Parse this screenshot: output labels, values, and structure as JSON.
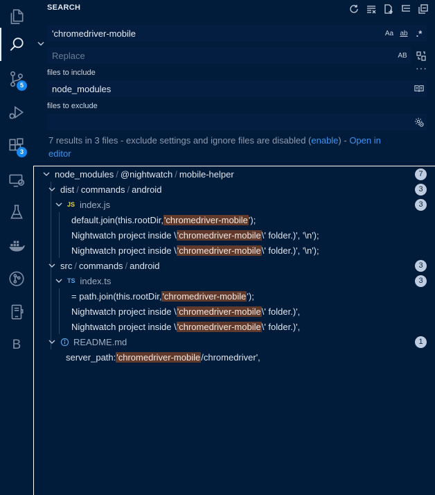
{
  "panel": {
    "title": "SEARCH"
  },
  "activity_bar": {
    "scm_badge": "5",
    "extensions_badge": "3",
    "last_item_letter": "B"
  },
  "search": {
    "query": "'chromedriver-mobile",
    "match_case": "Aa",
    "whole_word": "ab",
    "regex": ".*",
    "replace_placeholder": "Replace",
    "preserve_case": "AB"
  },
  "include": {
    "label": "files to include",
    "value": "node_modules"
  },
  "exclude": {
    "label": "files to exclude",
    "value": ""
  },
  "summary": {
    "text": "7 results in 3 files - exclude settings and ignore files are disabled (",
    "enable_link": "enable",
    "middle": ") - ",
    "open_link_part1": "Open in",
    "open_link_part2": "editor"
  },
  "tree": {
    "root": {
      "seg1": "node_modules",
      "seg2": "@nightwatch",
      "seg3": "mobile-helper",
      "count": "7"
    },
    "folder1": {
      "seg1": "dist",
      "seg2": "commands",
      "seg3": "android",
      "count": "3"
    },
    "file1": {
      "type": "JS",
      "name": "index.js",
      "count": "3",
      "matches": [
        {
          "pre": "default.join(this.rootDir, ",
          "hit": "'chromedriver-mobile",
          "post": "');"
        },
        {
          "pre": "Nightwatch project inside \\",
          "hit": "'chromedriver-mobile",
          "post": "\\' folder.)', '\\n');"
        },
        {
          "pre": "Nightwatch project inside \\",
          "hit": "'chromedriver-mobile",
          "post": "\\' folder.)', '\\n');"
        }
      ]
    },
    "folder2": {
      "seg1": "src",
      "seg2": "commands",
      "seg3": "android",
      "count": "3"
    },
    "file2": {
      "type": "TS",
      "name": "index.ts",
      "count": "3",
      "matches": [
        {
          "pre": "= path.join(this.rootDir, ",
          "hit": "'chromedriver-mobile",
          "post": "');"
        },
        {
          "pre": "Nightwatch project inside \\",
          "hit": "'chromedriver-mobile",
          "post": "\\' folder.)',"
        },
        {
          "pre": "Nightwatch project inside \\",
          "hit": "'chromedriver-mobile",
          "post": "\\' folder.)',"
        }
      ]
    },
    "file3": {
      "name": "README.md",
      "count": "1",
      "matches": [
        {
          "pre": "server_path: ",
          "hit": "'chromedriver-mobile",
          "post": "/chromedriver',"
        }
      ]
    }
  }
}
